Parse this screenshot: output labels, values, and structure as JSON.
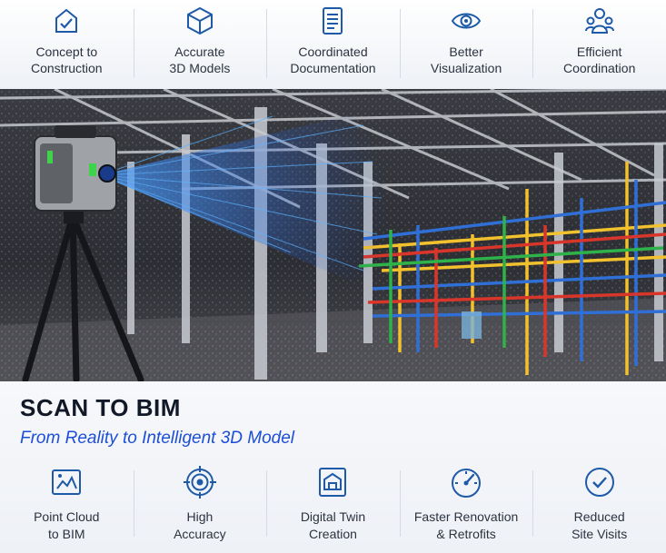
{
  "top_features": [
    {
      "label": "Concept to\nConstruction",
      "icon": "checklist-house-icon"
    },
    {
      "label": "Accurate\n3D Models",
      "icon": "3d-cube-icon"
    },
    {
      "label": "Coordinated\nDocumentation",
      "icon": "document-icon"
    },
    {
      "label": "Better\nVisualization",
      "icon": "eye-icon"
    },
    {
      "label": "Efficient\nCoordination",
      "icon": "team-icon"
    }
  ],
  "hero": {
    "title": "SCAN TO BIM",
    "subtitle": "From Reality to Intelligent 3D Model"
  },
  "bottom_features": [
    {
      "label": "Point Cloud\nto BIM",
      "icon": "point-cloud-icon"
    },
    {
      "label": "High\nAccuracy",
      "icon": "target-icon"
    },
    {
      "label": "Digital Twin\nCreation",
      "icon": "digital-twin-icon"
    },
    {
      "label": "Faster Renovation\n& Retrofits",
      "icon": "speedometer-icon"
    },
    {
      "label": "Reduced\nSite Visits",
      "icon": "check-circle-icon"
    }
  ],
  "colors": {
    "accent": "#1d4ed8",
    "icon": "#1e5aa8",
    "pipe_yellow": "#f2c12e",
    "pipe_blue": "#2f6fd6",
    "pipe_red": "#d9362b",
    "pipe_green": "#2fb24a"
  }
}
